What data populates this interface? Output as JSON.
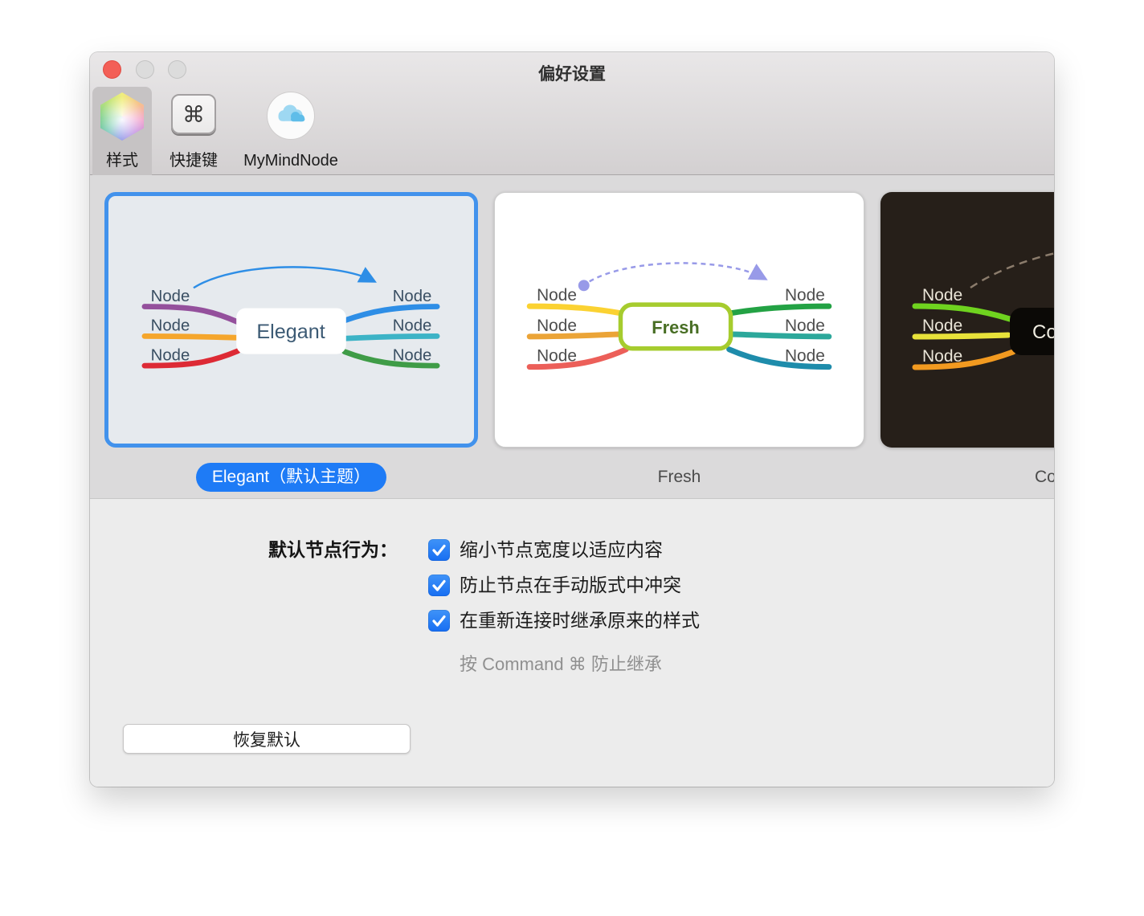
{
  "window": {
    "title": "偏好设置"
  },
  "toolbar": {
    "items": [
      {
        "label": "样式",
        "selected": true
      },
      {
        "label": "快捷键",
        "selected": false,
        "icon_glyph": "⌘"
      },
      {
        "label": "MyMindNode",
        "selected": false
      }
    ]
  },
  "themes": {
    "node_label": "Node",
    "cards": [
      {
        "caption": "Elegant（默认主题）",
        "center_label": "Elegant",
        "selected": true,
        "background": "#e6eaee",
        "selection_border": "#4292ec",
        "label_color": "#3a4f63",
        "center_text_color": "#3c5a74",
        "arrow_color": "#2e8ee6",
        "line_colors": [
          "#94509c",
          "#f5a62c",
          "#dd2a35",
          "#2e8ee6",
          "#3cb3c6",
          "#3f9c47"
        ]
      },
      {
        "caption": "Fresh",
        "center_label": "Fresh",
        "selected": false,
        "background": "#ffffff",
        "center_border_color": "#a6cc2e",
        "label_color": "#4d4d4d",
        "center_text_color": "#486e24",
        "arrow_color": "#989ae8",
        "line_colors": [
          "#fbd232",
          "#eba437",
          "#ec5f59",
          "#23a244",
          "#2ca89b",
          "#1e8cab"
        ]
      },
      {
        "caption": "Co",
        "center_label": "Co",
        "selected": false,
        "background": "#261f19",
        "label_color": "#eae5d8",
        "center_text_color": "#f0ede1",
        "arrow_color": "#8b7c6c",
        "line_colors": [
          "#6fd31f",
          "#e8e23a",
          "#f29a20"
        ]
      }
    ]
  },
  "settings": {
    "group_label": "默认节点行为：",
    "checkboxes": [
      {
        "label": "缩小节点宽度以适应内容",
        "checked": true
      },
      {
        "label": "防止节点在手动版式中冲突",
        "checked": true
      },
      {
        "label": "在重新连接时继承原来的样式",
        "checked": true
      }
    ],
    "hint": "按 Command ⌘ 防止继承",
    "reset_button": "恢复默认"
  },
  "colors": {
    "selection_blue": "#1e7bf6",
    "checkbox_blue": "#1d7cf5",
    "titlebar_top": "#e9e7e8",
    "titlebar_bottom": "#d3d0d1",
    "strip_bg": "#dbdadb",
    "settings_bg": "#ececec",
    "traffic_red": "#f35f57",
    "traffic_gray": "#dcdcdc"
  }
}
